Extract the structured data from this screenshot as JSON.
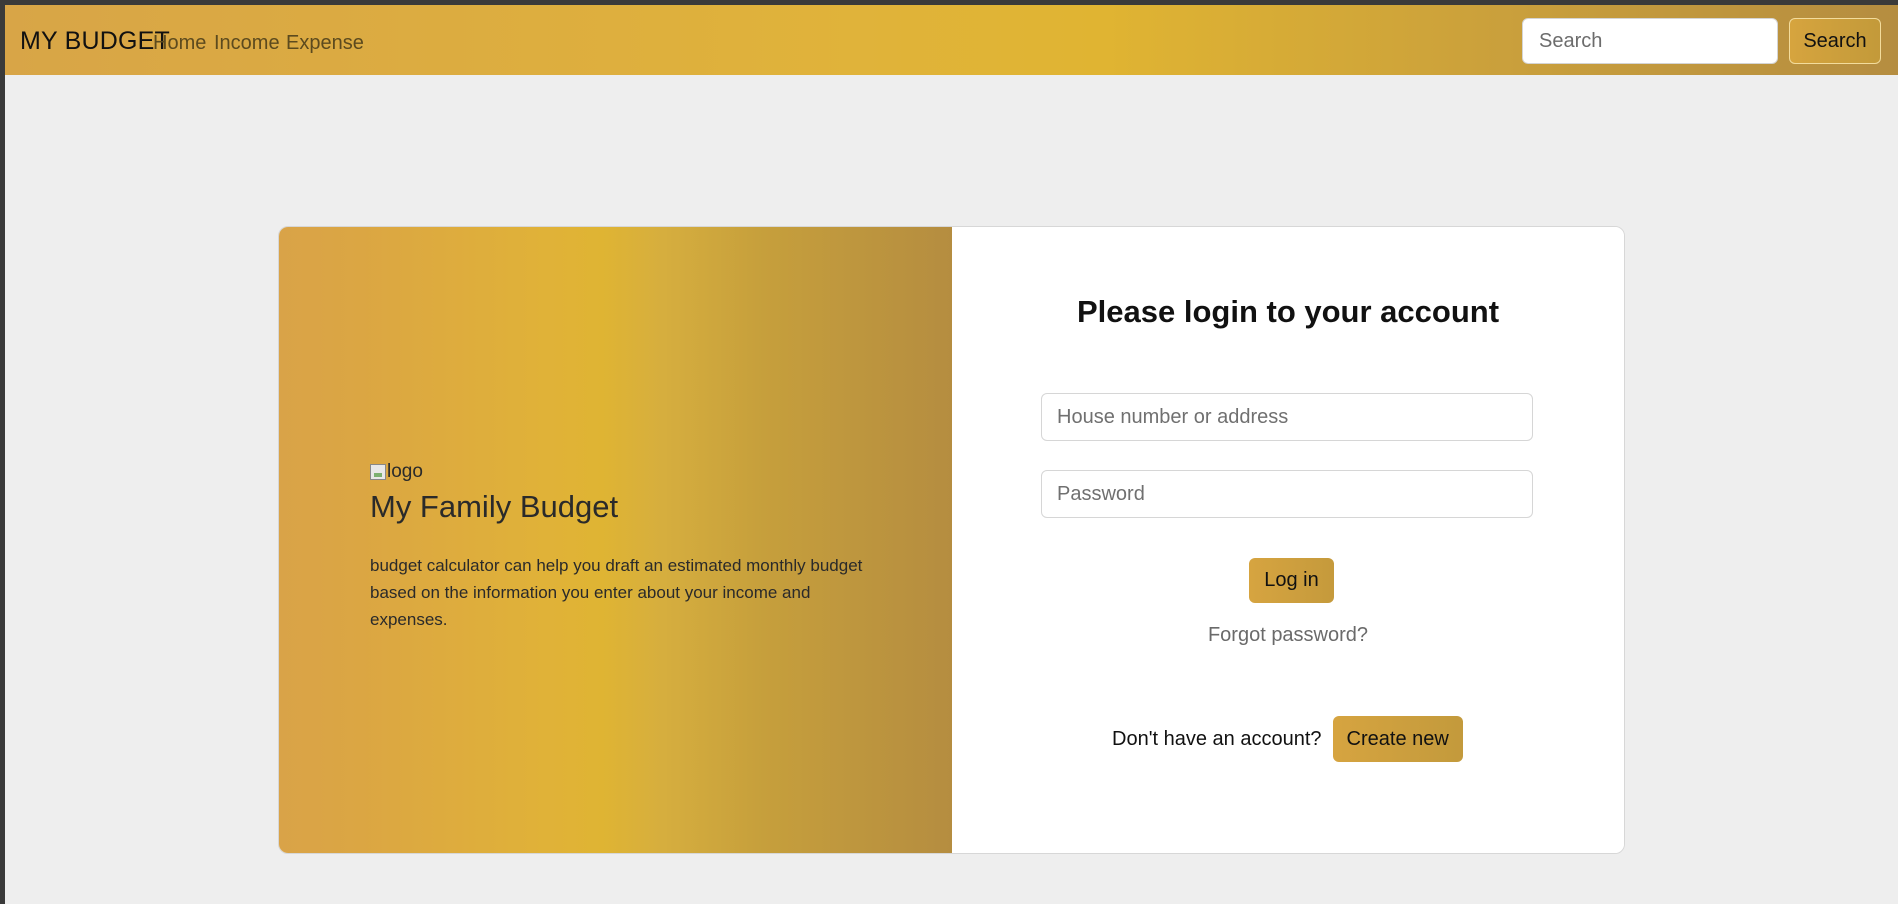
{
  "navbar": {
    "brand": "MY BUDGET",
    "links": [
      {
        "label": "Home"
      },
      {
        "label": "Income"
      },
      {
        "label": "Expense"
      }
    ],
    "search": {
      "placeholder": "Search",
      "button_label": "Search"
    }
  },
  "info_panel": {
    "logo_alt": "logo",
    "title": "My Family Budget",
    "description": "budget calculator can help you draft an estimated monthly budget based on the information you enter about your income and expenses."
  },
  "login": {
    "title": "Please login to your account",
    "address_placeholder": "House number or address",
    "password_placeholder": "Password",
    "login_label": "Log in",
    "forgot_label": "Forgot password?",
    "no_account_text": "Don't have an account?",
    "create_label": "Create new"
  },
  "colors": {
    "accent_gold": "#e0b432",
    "accent_amber": "#d9a348",
    "accent_bronze": "#b58d40",
    "page_background": "#eeeeee"
  }
}
